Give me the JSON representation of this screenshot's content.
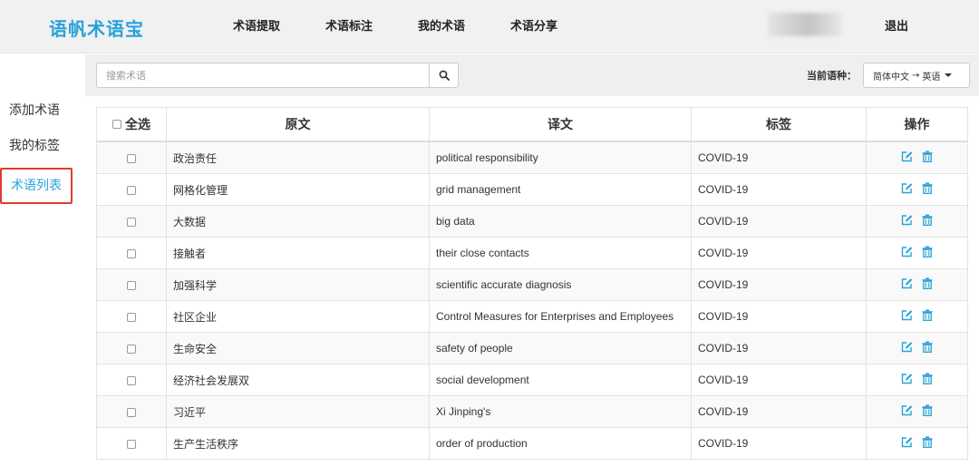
{
  "app": {
    "logo": "语帆术语宝"
  },
  "nav": [
    {
      "label": "术语提取"
    },
    {
      "label": "术语标注"
    },
    {
      "label": "我的术语"
    },
    {
      "label": "术语分享"
    }
  ],
  "header": {
    "logout": "退出"
  },
  "sidebar": {
    "items": [
      {
        "label": "添加术语",
        "active": false
      },
      {
        "label": "我的标签",
        "active": false
      },
      {
        "label": "术语列表",
        "active": true
      }
    ]
  },
  "toolbar": {
    "search_placeholder": "搜索术语",
    "search_value": "",
    "lang_label": "当前语种：",
    "lang_source": "简体中文",
    "lang_arrow": "→",
    "lang_target": "英语"
  },
  "colors": {
    "accent": "#2aa2d8",
    "active_border": "#e23b32"
  },
  "table": {
    "headers": {
      "select_all": "全选",
      "source": "原文",
      "target": "译文",
      "tag": "标签",
      "actions": "操作"
    },
    "rows": [
      {
        "source": "政治责任",
        "target": "political responsibility",
        "tag": "COVID-19"
      },
      {
        "source": "网格化管理",
        "target": "grid management",
        "tag": "COVID-19"
      },
      {
        "source": "大数据",
        "target": "big data",
        "tag": "COVID-19"
      },
      {
        "source": "接触者",
        "target": "their close contacts",
        "tag": "COVID-19"
      },
      {
        "source": "加强科学",
        "target": "scientific accurate diagnosis",
        "tag": "COVID-19"
      },
      {
        "source": "社区企业",
        "target": "Control Measures for Enterprises and Employees",
        "tag": "COVID-19"
      },
      {
        "source": "生命安全",
        "target": "safety of people",
        "tag": "COVID-19"
      },
      {
        "source": "经济社会发展双",
        "target": "social development",
        "tag": "COVID-19"
      },
      {
        "source": "习近平",
        "target": "Xi Jinping's",
        "tag": "COVID-19"
      },
      {
        "source": "生产生活秩序",
        "target": "order of production",
        "tag": "COVID-19"
      }
    ]
  }
}
